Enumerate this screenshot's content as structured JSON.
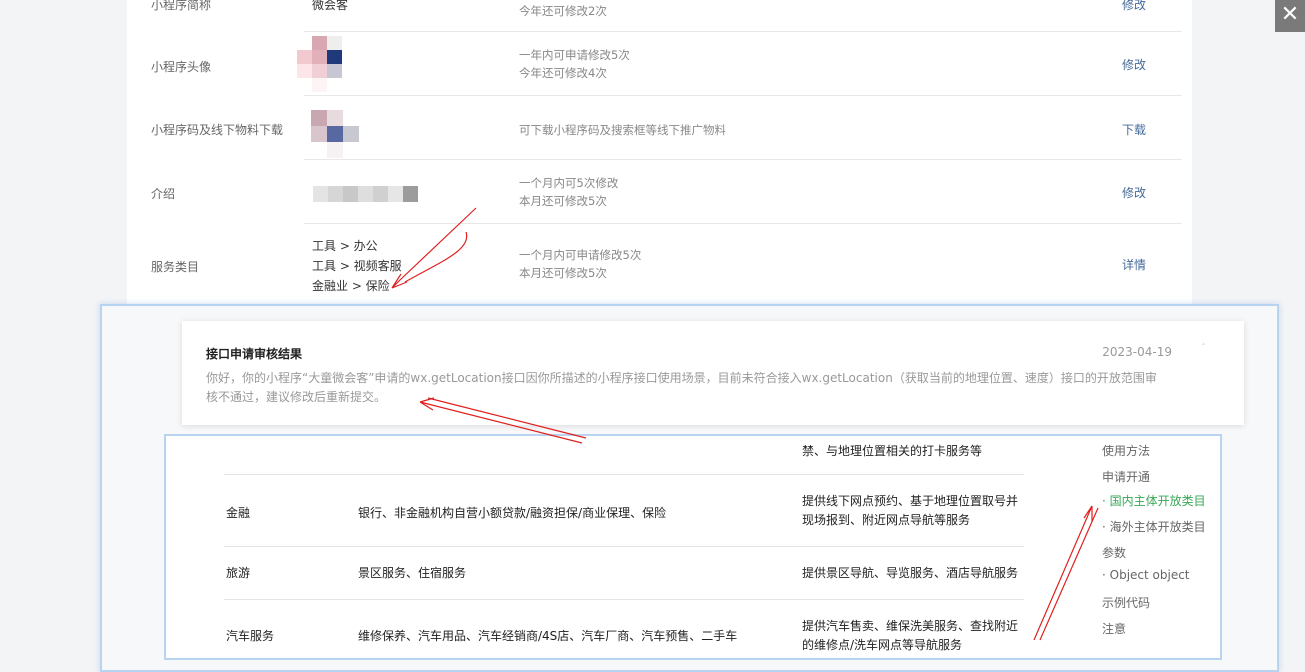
{
  "window": {
    "close_label": "✕"
  },
  "settings": {
    "rows": [
      {
        "label": "小程序简称",
        "value": "微会客",
        "desc1": "今年还可修改2次",
        "desc2": "",
        "action": "修改"
      },
      {
        "label": "小程序头像",
        "value": "",
        "desc1": "一年内可申请修改5次",
        "desc2": "今年还可修改4次",
        "action": "修改"
      },
      {
        "label": "小程序码及线下物料下载",
        "value": "",
        "desc1": "可下载小程序码及搜索框等线下推广物料",
        "desc2": "",
        "action": "下载"
      },
      {
        "label": "介绍",
        "value": "",
        "desc1": "一个月内可5次修改",
        "desc2": "本月还可修改5次",
        "action": "修改"
      },
      {
        "label": "服务类目",
        "value": "",
        "desc1": "一个月内可申请修改5次",
        "desc2": "本月还可修改5次",
        "action": "详情"
      }
    ],
    "categories": [
      "工具 > 办公",
      "工具 > 视频客服",
      "金融业 > 保险"
    ]
  },
  "notice": {
    "title": "接口申请审核结果",
    "date": "2023-04-19",
    "chevron": "ˆ",
    "body": "你好，你的小程序“大童微会客”申请的wx.getLocation接口因你所描述的小程序接口使用场景，目前未符合接入wx.getLocation（获取当前的地理位置、速度）接口的开放范围审核不通过，建议修改后重新提交。"
  },
  "doc": {
    "partial_top": "禁、与地理位置相关的打卡服务等",
    "rows": [
      {
        "category": "金融",
        "sub": "银行、非金融机构自营小额贷款/融资担保/商业保理、保险",
        "scene": "提供线下网点预约、基于地理位置取号并现场报到、附近网点导航等服务"
      },
      {
        "category": "旅游",
        "sub": "景区服务、住宿服务",
        "scene": "提供景区导航、导览服务、酒店导航服务"
      },
      {
        "category": "汽车服务",
        "sub": "维修保养、汽车用品、汽车经销商/4S店、汽车厂商、汽车预售、二手车",
        "scene": "提供汽车售卖、维保洗美服务、查找附近的维修点/洗车网点等导航服务"
      }
    ],
    "toc": [
      {
        "label": "使用方法",
        "active": false
      },
      {
        "label": "申请开通",
        "active": false
      },
      {
        "label": "· 国内主体开放类目",
        "active": true
      },
      {
        "label": "· 海外主体开放类目",
        "active": false
      },
      {
        "label": "参数",
        "active": false
      },
      {
        "label": "· Object object",
        "active": false
      },
      {
        "label": "示例代码",
        "active": false
      },
      {
        "label": "注意",
        "active": false
      }
    ]
  },
  "colors": {
    "accent_green": "#3aa757",
    "link_blue": "#456b9a",
    "annotation_red": "#e02020"
  }
}
